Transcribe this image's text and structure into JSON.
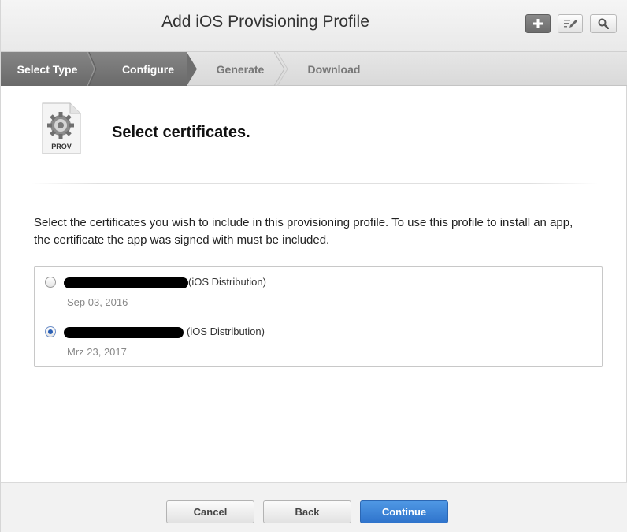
{
  "window": {
    "title": "Add iOS Provisioning Profile"
  },
  "toolbar": {
    "add_icon": "plus-icon",
    "edit_icon": "edit-icon",
    "search_icon": "search-icon"
  },
  "steps": [
    {
      "label": "Select Type",
      "state": "done"
    },
    {
      "label": "Configure",
      "state": "current"
    },
    {
      "label": "Generate",
      "state": "upcoming"
    },
    {
      "label": "Download",
      "state": "upcoming"
    }
  ],
  "section": {
    "icon_label": "PROV",
    "heading": "Select certificates.",
    "description": "Select the certificates you wish to include in this provisioning profile. To use this profile to install an app, the certificate the app was signed with must be included."
  },
  "certificates": [
    {
      "type": "(iOS Distribution)",
      "date": "Sep 03, 2016",
      "selected": false
    },
    {
      "type": "(iOS Distribution)",
      "date": "Mrz 23, 2017",
      "selected": true
    }
  ],
  "footer": {
    "cancel_label": "Cancel",
    "back_label": "Back",
    "continue_label": "Continue"
  },
  "colors": {
    "primary": "#2f74cc",
    "step_done": "#787878",
    "radio_selected": "#2a5fb5"
  }
}
